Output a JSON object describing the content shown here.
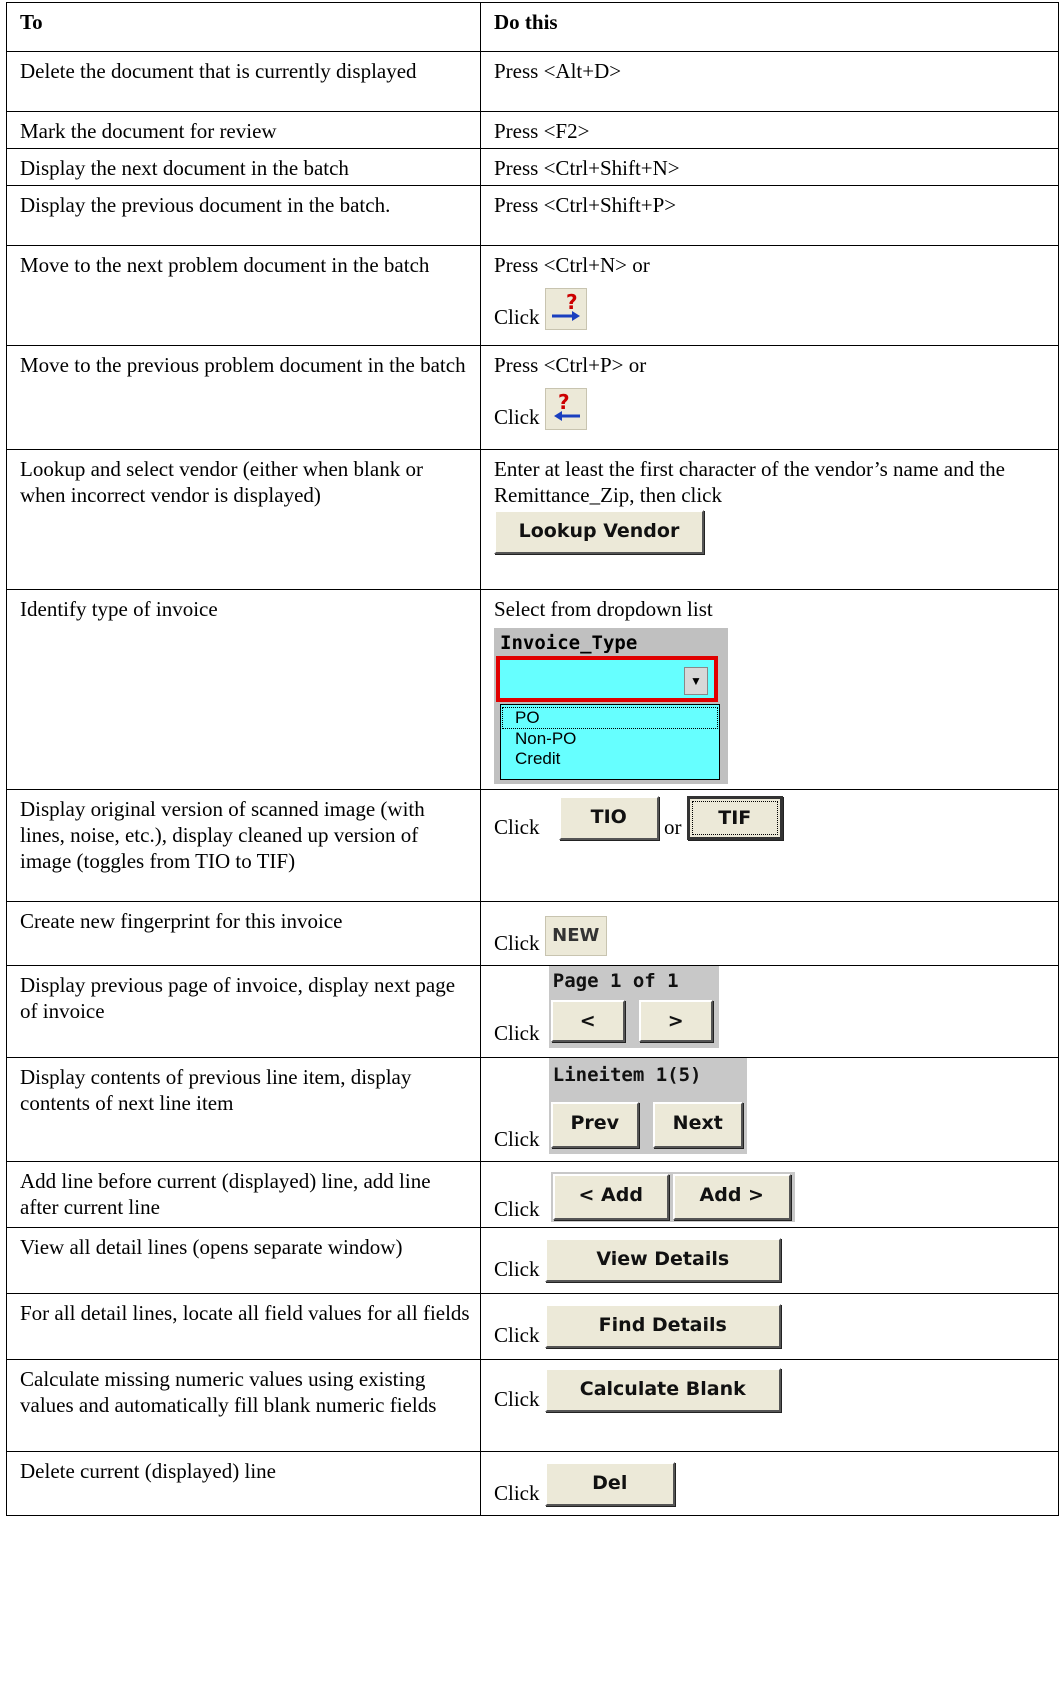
{
  "header": {
    "col1": "To",
    "col2": "Do this"
  },
  "rows": [
    {
      "to": "Delete the document that is currently displayed",
      "do": "Press <Alt+D>"
    },
    {
      "to": "Mark the document for review",
      "do": "Press <F2>"
    },
    {
      "to": "Display the next document in the batch",
      "do": "Press <Ctrl+Shift+N>"
    },
    {
      "to": "Display the previous document in the batch.",
      "do": "Press <Ctrl+Shift+P>"
    },
    {
      "to": "Move to the next problem document in the batch",
      "do": "Press <Ctrl+N> or",
      "click": "Click"
    },
    {
      "to": "Move to the previous problem document in the batch",
      "do": "Press <Ctrl+P> or",
      "click": "Click"
    },
    {
      "to": "Lookup and select vendor (either when blank or when incorrect vendor is displayed)",
      "do": "Enter at least the first character of the vendor’s name and the Remittance_Zip, then click",
      "button": "Lookup Vendor"
    },
    {
      "to": "Identify type of invoice",
      "do": "Select from dropdown list",
      "dropdown": {
        "label": "Invoice_Type",
        "options": [
          "PO",
          "Non-PO",
          "Credit"
        ]
      }
    },
    {
      "to": "Display original version of scanned image (with lines, noise, etc.), display cleaned up version of image (toggles from TIO to TIF)",
      "click": "Click",
      "btn1": "TIO",
      "or": "or",
      "btn2": "TIF"
    },
    {
      "to": "Create new fingerprint for this invoice",
      "click": "Click",
      "icon_text": "NEW"
    },
    {
      "to": "Display previous page of invoice, display next page of invoice",
      "click": "Click",
      "panel_label": "Page 1 of 1",
      "btn1": "<",
      "btn2": ">"
    },
    {
      "to": "Display contents of previous line item, display contents of next line item",
      "click": "Click",
      "panel_label": "Lineitem 1(5)",
      "btn1": "Prev",
      "btn2": "Next"
    },
    {
      "to": "Add line before current (displayed) line, add line after current line",
      "click": "Click",
      "btn1": "< Add",
      "btn2": "Add >"
    },
    {
      "to": "View all detail lines (opens separate window)",
      "click": "Click",
      "button": "View Details"
    },
    {
      "to": "For all detail lines, locate all field values for all fields",
      "click": "Click",
      "button": "Find Details"
    },
    {
      "to": "Calculate missing numeric values using existing values and automatically fill blank numeric fields",
      "click": "Click",
      "button": "Calculate Blank"
    },
    {
      "to": "Delete current (displayed) line",
      "click": "Click",
      "button": "Del"
    }
  ]
}
